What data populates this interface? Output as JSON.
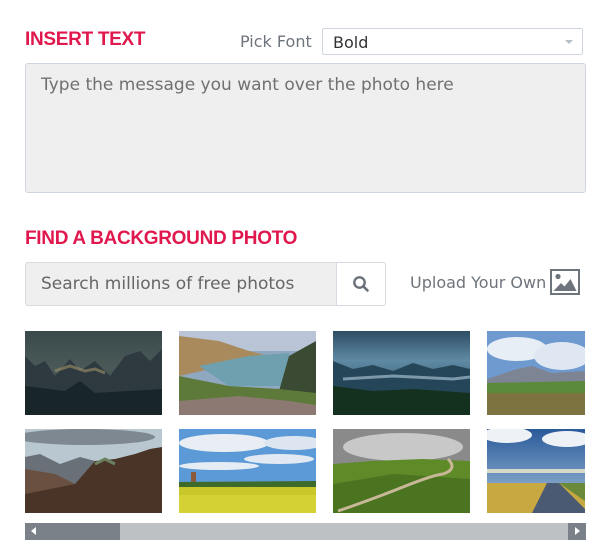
{
  "insert_text": {
    "heading": "INSERT TEXT",
    "pick_font_label": "Pick Font",
    "font_select": {
      "selected": "Bold"
    },
    "message_placeholder": "Type the message you want over the photo here",
    "message_value": ""
  },
  "background": {
    "heading": "FIND A BACKGROUND PHOTO",
    "search_placeholder": "Search millions of free photos",
    "search_value": "",
    "search_icon": "search-icon",
    "upload_label": "Upload Your Own",
    "upload_icon": "image-icon"
  },
  "photos": [
    {
      "name": "photo-misty-dark-peaks",
      "subject": "misty dark mountain peaks"
    },
    {
      "name": "photo-coastal-cove",
      "subject": "coastal cliffs and cove"
    },
    {
      "name": "photo-blue-valley-fog",
      "subject": "blue valley with fog"
    },
    {
      "name": "photo-meadow-mountain",
      "subject": "meadow with distant mountain"
    },
    {
      "name": "photo-rugged-hills",
      "subject": "rugged autumn hills"
    },
    {
      "name": "photo-rapeseed-windmill",
      "subject": "rapeseed field with windmill"
    },
    {
      "name": "photo-green-hill-path",
      "subject": "green hill with winding path"
    },
    {
      "name": "photo-canal-field",
      "subject": "canal through golden field"
    }
  ],
  "scrollbar": {
    "position_fraction": 0.0,
    "visible_fraction": 0.17
  },
  "colors": {
    "accent": "#e0184d",
    "scroll_thumb": "#7a8188",
    "scroll_track": "#bdc1c4"
  }
}
